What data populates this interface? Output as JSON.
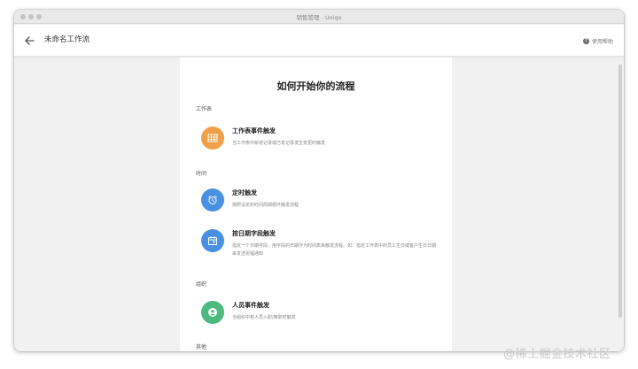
{
  "window": {
    "title": "销售管理 - Uxiqo"
  },
  "appbar": {
    "title": "未命名工作流",
    "help_label": "使用帮助"
  },
  "card": {
    "heading": "如何开始你的流程",
    "sections": [
      {
        "label": "工作表",
        "options": [
          {
            "title": "工作表事件触发",
            "desc": "当工作表中新增记录或已有记录发生变更时触发",
            "icon": "table-icon",
            "color": "#f0a04b"
          }
        ]
      },
      {
        "label": "时间",
        "options": [
          {
            "title": "定时触发",
            "desc": "按照设定的时间周期循环触发流程",
            "icon": "alarm-clock-icon",
            "color": "#4a90e2"
          },
          {
            "title": "按日期字段触发",
            "desc": "指定一个日期字段，用字段的日期作为时间表来触发流程。如：指定工作表中的员工生日或客户生日日期来发送祝福通知",
            "icon": "calendar-icon",
            "color": "#4a90e2"
          }
        ]
      },
      {
        "label": "组织",
        "options": [
          {
            "title": "人员事件触发",
            "desc": "当组织中有人员入职/离职时触发",
            "icon": "person-icon",
            "color": "#4cba7e"
          }
        ]
      },
      {
        "label": "其他",
        "options": []
      }
    ]
  },
  "watermark": "@稀土掘金技术社区",
  "colors": {
    "window_bg": "#f1f1f1",
    "card_bg": "#ffffff",
    "orange": "#f0a04b",
    "blue": "#4a90e2",
    "green": "#4cba7e"
  }
}
